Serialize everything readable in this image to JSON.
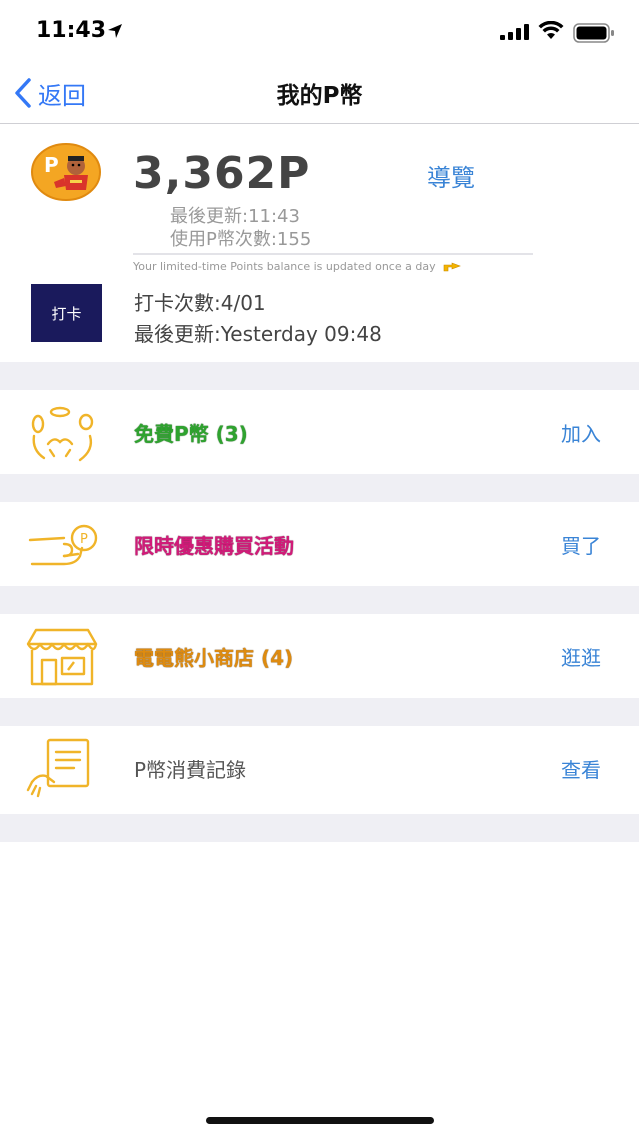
{
  "status_bar": {
    "time": "11:43"
  },
  "nav": {
    "back_label": "返回",
    "title": "我的P幣"
  },
  "points": {
    "value": "3,362P",
    "browse_label": "導覽",
    "last_updated": "最後更新:11:43",
    "usage_count": "使用P幣次數:155",
    "balance_note": "Your limited-time Points balance is updated once a day"
  },
  "checkin": {
    "button_label": "打卡",
    "count": "打卡次數:4/01",
    "last_updated": "最後更新:Yesterday 09:48"
  },
  "rows": [
    {
      "label": "免費P幣 (3)",
      "action": "加入",
      "color": "#2fa32f",
      "icon": "coins-hands-icon"
    },
    {
      "label": "限時優惠購買活動",
      "action": "買了",
      "color": "#d21a79",
      "icon": "hand-coin-icon"
    },
    {
      "label": "電電熊小商店 (4)",
      "action": "逛逛",
      "color": "#de8b10",
      "icon": "store-icon"
    },
    {
      "label": "P幣消費記錄",
      "action": "查看",
      "color": "#555555",
      "icon": "receipt-hand-icon"
    }
  ],
  "colors": {
    "accent": "#3478f6",
    "link": "#3a84d6",
    "icon_gold": "#f0b429",
    "separator": "#efeff4"
  }
}
